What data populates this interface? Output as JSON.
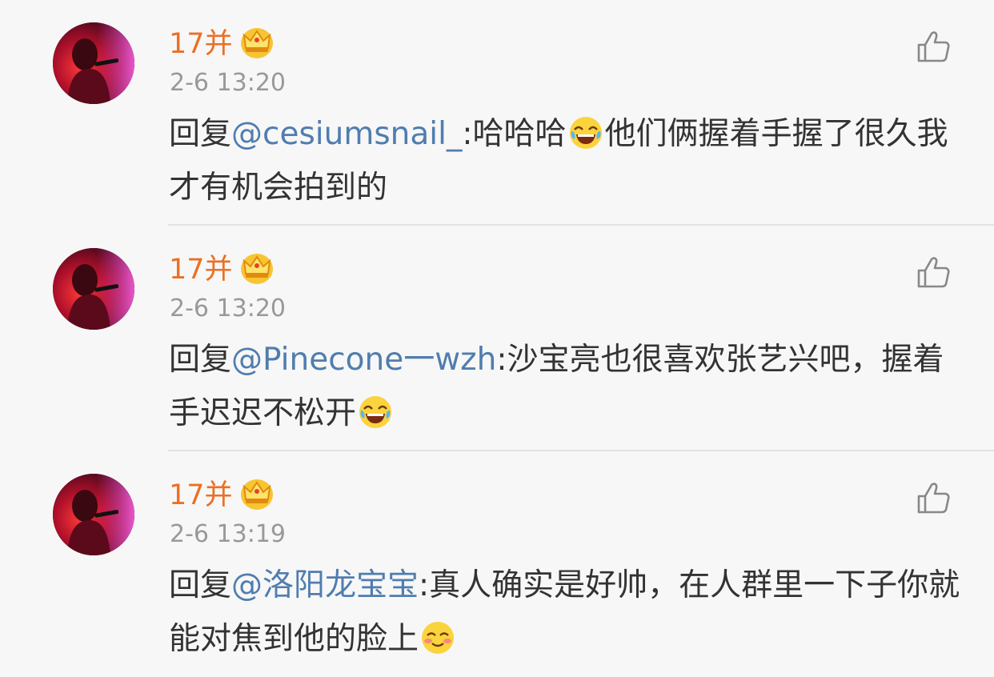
{
  "comments": [
    {
      "username": "17并",
      "timestamp": "2-6 13:20",
      "reply_prefix": "回复",
      "mention": "@cesiumsnail_",
      "text_before_emoji": ":哈哈哈",
      "text_after_emoji": "他们俩握着手握了很久我才有机会拍到的",
      "emoji": "tears-of-joy-emoji"
    },
    {
      "username": "17并",
      "timestamp": "2-6 13:20",
      "reply_prefix": "回复",
      "mention": "@Pinecone一wzh",
      "text_before_emoji": ":沙宝亮也很喜欢张艺兴吧，握着手迟迟不松开",
      "text_after_emoji": "",
      "emoji": "tears-of-joy-emoji"
    },
    {
      "username": "17并",
      "timestamp": "2-6 13:19",
      "reply_prefix": "回复",
      "mention": "@洛阳龙宝宝",
      "text_before_emoji": ":真人确实是好帅，在人群里一下子你就能对焦到他的脸上",
      "text_after_emoji": "",
      "emoji": "blushing-smile-emoji"
    }
  ],
  "colors": {
    "background": "#f7f7f7",
    "username": "#eb7024",
    "timestamp": "#999999",
    "text": "#333333",
    "mention": "#507daf",
    "divider": "#e2e2e2"
  },
  "icons": {
    "badge": "crown-icon",
    "like": "thumbs-up-icon",
    "avatar": "performer-photo"
  }
}
